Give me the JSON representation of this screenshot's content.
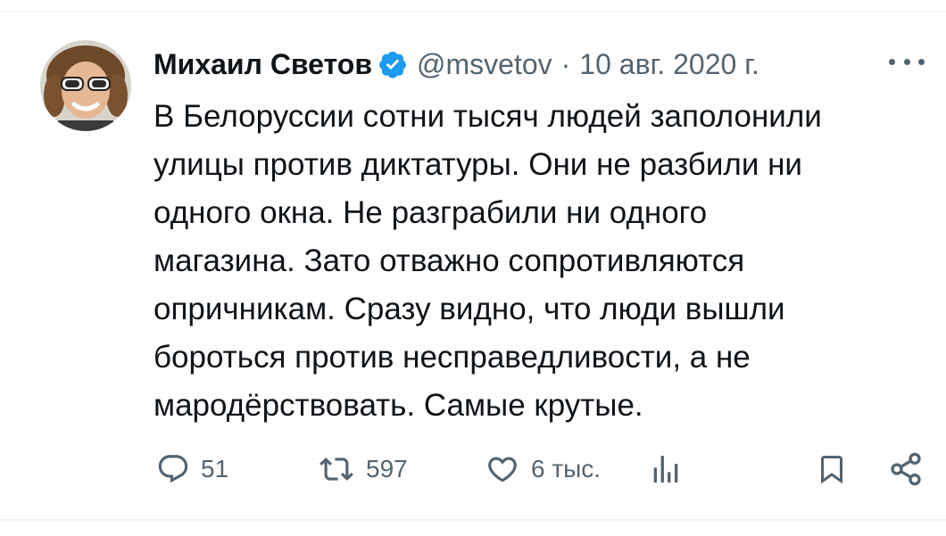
{
  "tweet": {
    "author_name": "Михаил Светов",
    "author_handle": "@msvetov",
    "separator": "·",
    "date": "10 авг. 2020 г.",
    "text_lines": [
      "В Белоруссии сотни тысяч людей заполонили",
      "улицы против диктатуры. Они не разбили ни",
      "одного окна. Не разграбили ни одного",
      "магазина. Зато отважно сопротивляются",
      "опричникам. Сразу видно, что люди вышли",
      "бороться против несправедливости, а не",
      "мародёрствовать. Самые крутые."
    ]
  },
  "actions": {
    "reply": {
      "icon": "reply-icon",
      "count": "51"
    },
    "retweet": {
      "icon": "retweet-icon",
      "count": "597"
    },
    "like": {
      "icon": "heart-icon",
      "count": "6 тыс."
    },
    "views": {
      "icon": "analytics-icon"
    },
    "bookmark": {
      "icon": "bookmark-icon"
    },
    "share": {
      "icon": "share-icon"
    }
  },
  "colors": {
    "text": "#0f1419",
    "secondary": "#536471",
    "verified": "#1d9bf0",
    "divider": "#eff3f4"
  }
}
